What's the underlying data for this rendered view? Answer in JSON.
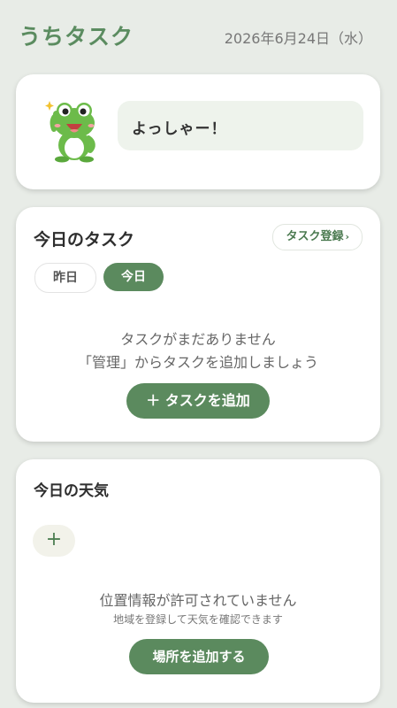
{
  "header": {
    "title": "うちタスク",
    "date": "2026年6月24日（水）"
  },
  "frog_card": {
    "message": "よっしゃー！",
    "mascot_icon": "waving-frog-icon"
  },
  "tasks": {
    "title": "今日のタスク",
    "register_label": "タスク登録",
    "register_chevron": "›",
    "tabs": [
      "昨日",
      "今日"
    ],
    "selected_tab": "今日",
    "empty_line1": "タスクがまだありません",
    "empty_line2": "「管理」からタスクを追加しましょう",
    "add_label": "＋ タスクを追加"
  },
  "weather": {
    "title": "今日の天気",
    "add_icon_text": "+",
    "empty_line1": "位置情報が許可されていません",
    "empty_line2": "地域を登録して天気を確認できます",
    "add_place_label": "場所を追加する"
  },
  "colors": {
    "accent": "#5b8a5e",
    "title_green": "#5b8c60",
    "background": "#e8ece7"
  }
}
